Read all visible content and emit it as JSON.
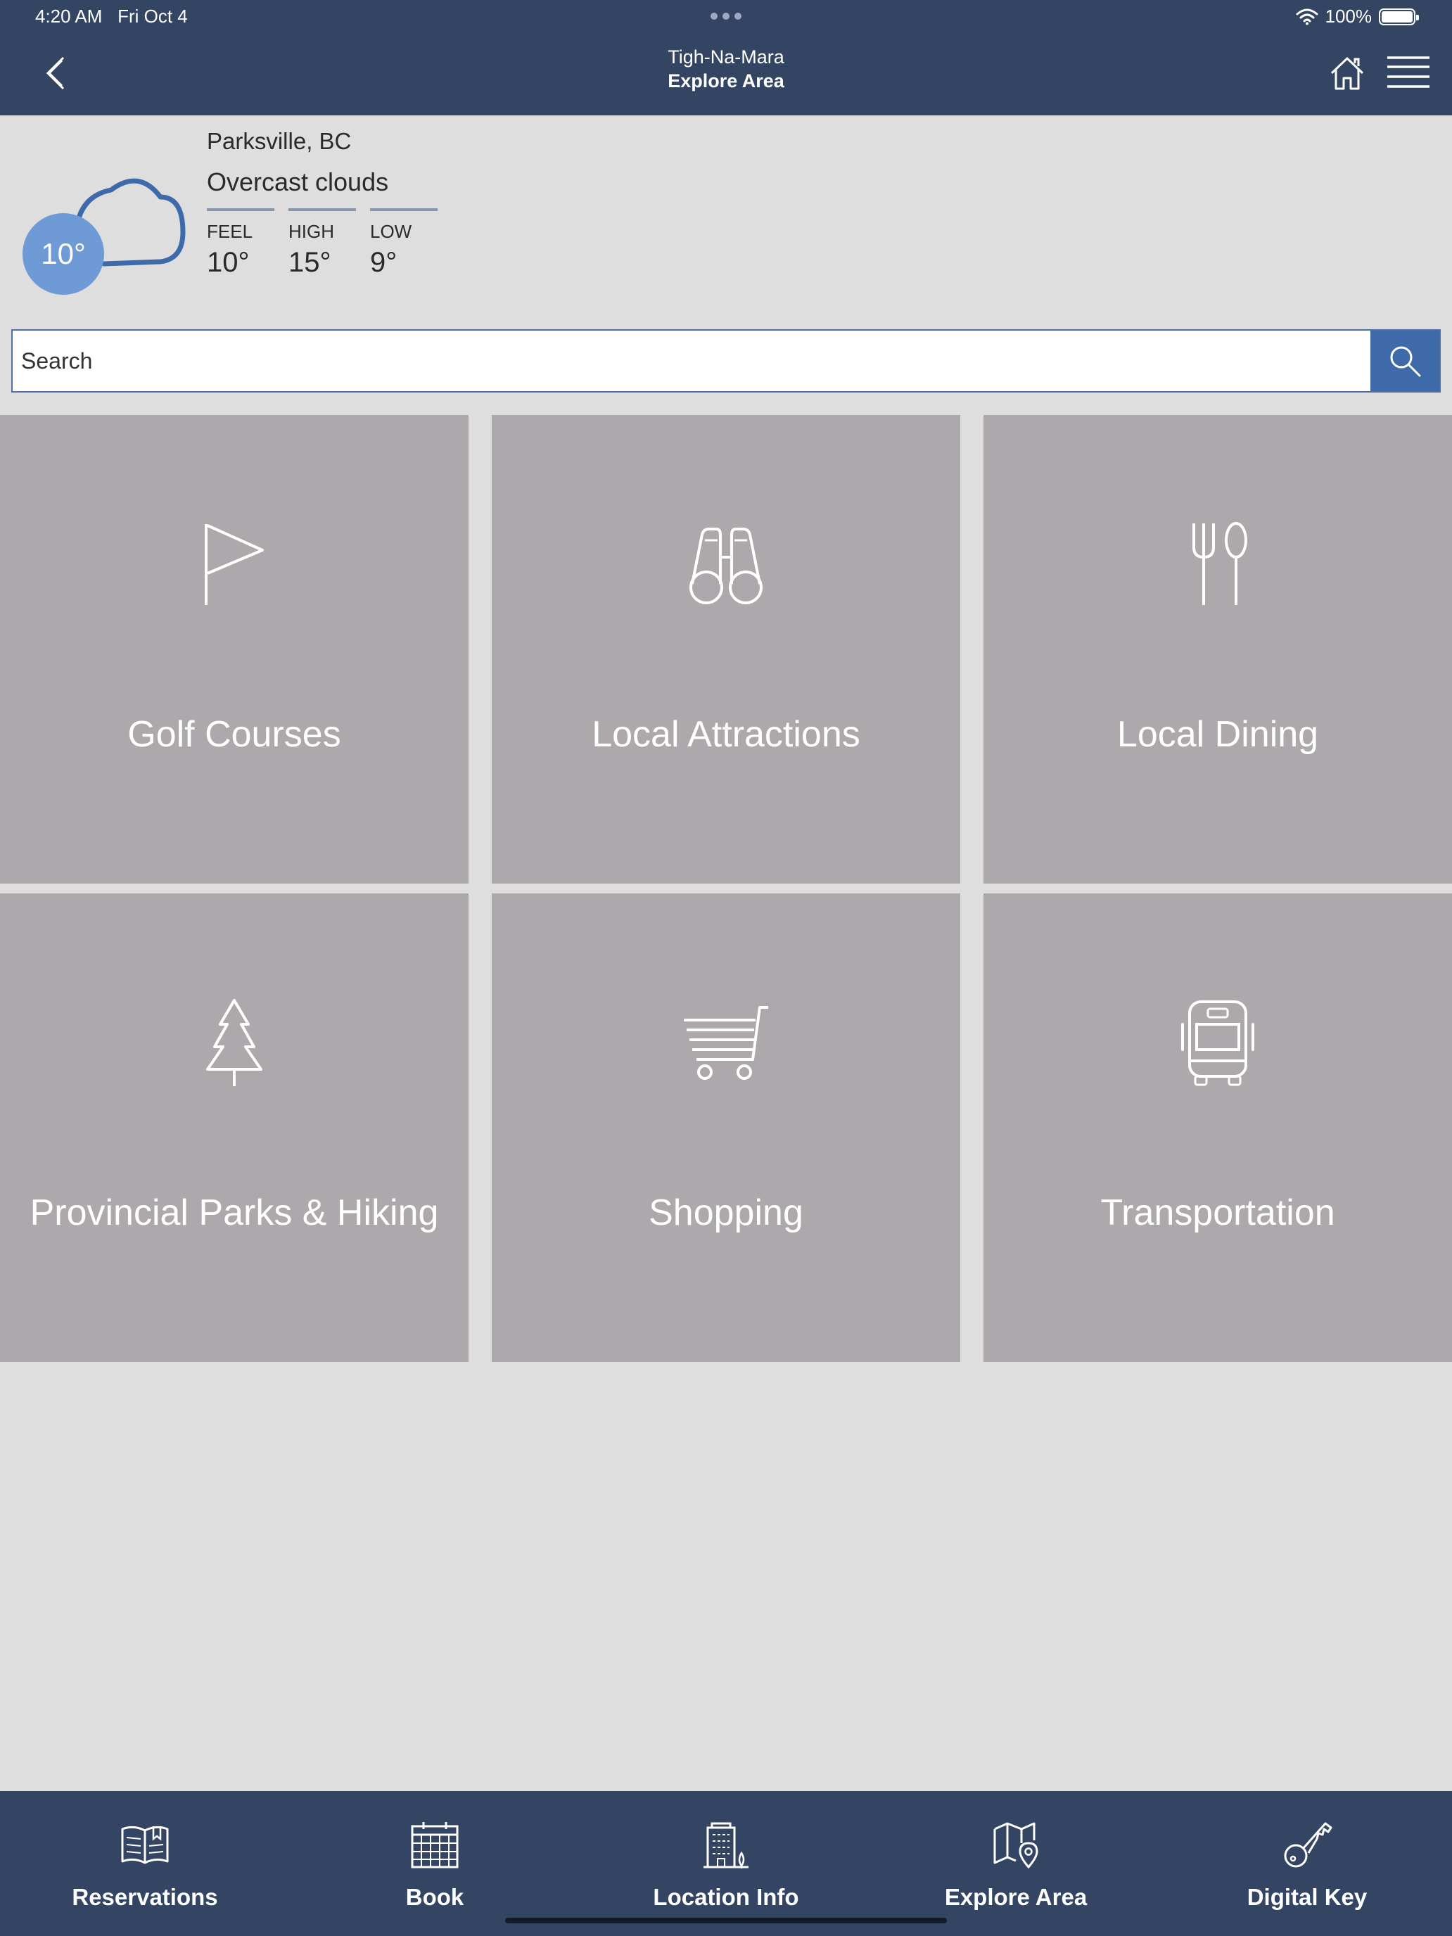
{
  "status_bar": {
    "time": "4:20 AM",
    "date": "Fri Oct 4",
    "battery": "100%",
    "battery_level": 1.0
  },
  "nav": {
    "hotel_name": "Tigh-Na-Mara",
    "page_title": "Explore Area"
  },
  "weather": {
    "city": "Parksville, BC",
    "description": "Overcast clouds",
    "temperature": "10°",
    "feel_label": "FEEL",
    "feel": "10°",
    "high_label": "HIGH",
    "high": "15°",
    "low_label": "LOW",
    "low": "9°"
  },
  "search": {
    "placeholder": "Search",
    "value": ""
  },
  "categories": [
    {
      "label": "Golf Courses",
      "icon": "flag-icon"
    },
    {
      "label": "Local Attractions",
      "icon": "binoculars-icon"
    },
    {
      "label": "Local Dining",
      "icon": "fork-spoon-icon"
    },
    {
      "label": "Provincial Parks & Hiking",
      "icon": "tree-icon"
    },
    {
      "label": "Shopping",
      "icon": "cart-icon"
    },
    {
      "label": "Transportation",
      "icon": "bus-icon"
    }
  ],
  "tabs": [
    {
      "label": "Reservations",
      "icon": "book-icon"
    },
    {
      "label": "Book",
      "icon": "calendar-icon"
    },
    {
      "label": "Location Info",
      "icon": "building-icon"
    },
    {
      "label": "Explore Area",
      "icon": "map-pin-icon"
    },
    {
      "label": "Digital Key",
      "icon": "key-icon"
    }
  ],
  "colors": {
    "header": "#344564",
    "accent": "#3f6aaa",
    "tile": "#aca8ac",
    "background": "#dedede",
    "temp_circle": "#6e9ad6"
  }
}
